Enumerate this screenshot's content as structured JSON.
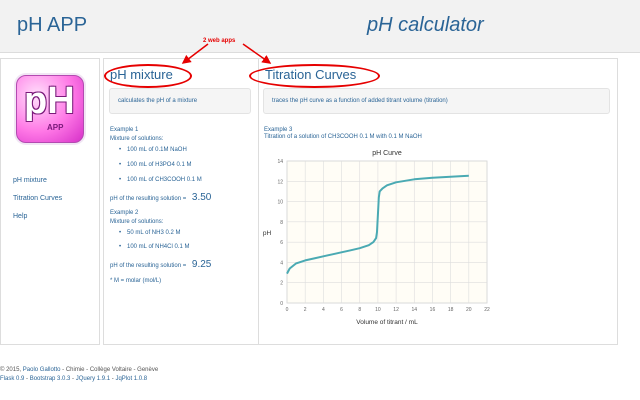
{
  "header": {
    "brand": "pH APP",
    "title": "pH calculator"
  },
  "logo": {
    "main": "pH",
    "sub": "APP"
  },
  "sidebar": {
    "items": [
      {
        "label": "pH mixture"
      },
      {
        "label": "Titration Curves"
      },
      {
        "label": "Help"
      }
    ]
  },
  "annotation": {
    "label": "2 web apps",
    "color": "#e60000"
  },
  "mixture": {
    "heading": "pH mixture",
    "description": "calculates the pH of a mixture",
    "example1": {
      "title": "Example 1",
      "intro": "Mixture of solutions:",
      "items": [
        "100 mL of 0.1M NaOH",
        "100 mL of H3PO4 0.1 M",
        "100 mL of CH3COOH 0.1 M"
      ],
      "result_label": "pH of the resulting solution =",
      "result_value": "3.50"
    },
    "example2": {
      "title": "Example 2",
      "intro": "Mixture of solutions:",
      "items": [
        "50 mL of NH3 0.2 M",
        "100 mL of NH4Cl 0.1 M"
      ],
      "result_label": "pH of the resulting solution =",
      "result_value": "9.25"
    },
    "footnote": "* M = molar (mol/L)"
  },
  "titration": {
    "heading": "Titration Curves",
    "description": "traces the pH curve as a function of added titrant volume (titration)",
    "example_title": "Example 3",
    "example_text": "Titration of a solution of CH3COOH 0.1 M with 0.1 M NaOH"
  },
  "chart_data": {
    "type": "line",
    "title": "pH Curve",
    "xlabel": "Volume of titrant / mL",
    "ylabel": "pH",
    "xlim": [
      0,
      22
    ],
    "ylim": [
      0,
      14
    ],
    "xticks": [
      "0",
      "2",
      "4",
      "6",
      "8",
      "10",
      "12",
      "14",
      "16",
      "18",
      "20",
      "22"
    ],
    "yticks": [
      "0",
      "2",
      "4",
      "6",
      "8",
      "10",
      "12",
      "14"
    ],
    "grid": true,
    "color": "#4aaab3",
    "series": [
      {
        "x": [
          0,
          0.3,
          1,
          2,
          3,
          4,
          5,
          6,
          7,
          8,
          9,
          9.5,
          9.8,
          9.9,
          10,
          10.1,
          10.2,
          10.5,
          11,
          12,
          14,
          16,
          18,
          20
        ],
        "y": [
          2.9,
          3.4,
          3.9,
          4.2,
          4.4,
          4.6,
          4.8,
          5.0,
          5.2,
          5.4,
          5.7,
          6.0,
          6.4,
          7.0,
          8.7,
          10.4,
          11.0,
          11.3,
          11.6,
          11.9,
          12.2,
          12.35,
          12.45,
          12.55
        ]
      }
    ]
  },
  "footer": {
    "line1_prefix": "© 2015,",
    "author": "Paolo Gallotto",
    "line1_rest": "- Chimie - Collège Voltaire - Genève",
    "flask": "Flask 0.9",
    "bootstrap": "Bootstrap 3.0.3",
    "jquery": "JQuery 1.9.1",
    "jqplot": "JqPlot 1.0.8"
  }
}
